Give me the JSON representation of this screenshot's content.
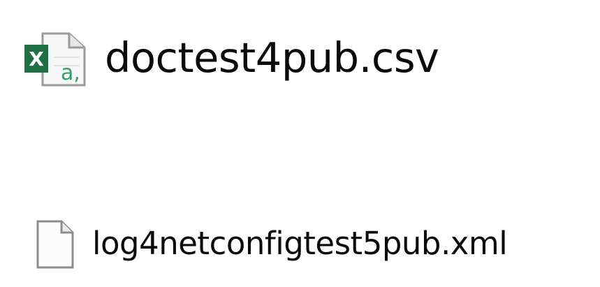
{
  "files": [
    {
      "name": "doctest4pub.csv",
      "icon": "excel-csv-file-icon",
      "icon_badge": "X",
      "icon_glyph": "a,",
      "colors": {
        "badge": "#1e7145",
        "glyph": "#33a06a",
        "page_border": "#9a9a9a"
      }
    },
    {
      "name": "log4netconfigtest5pub.xml",
      "icon": "blank-file-icon",
      "colors": {
        "page_border": "#8c8c8c"
      }
    }
  ]
}
